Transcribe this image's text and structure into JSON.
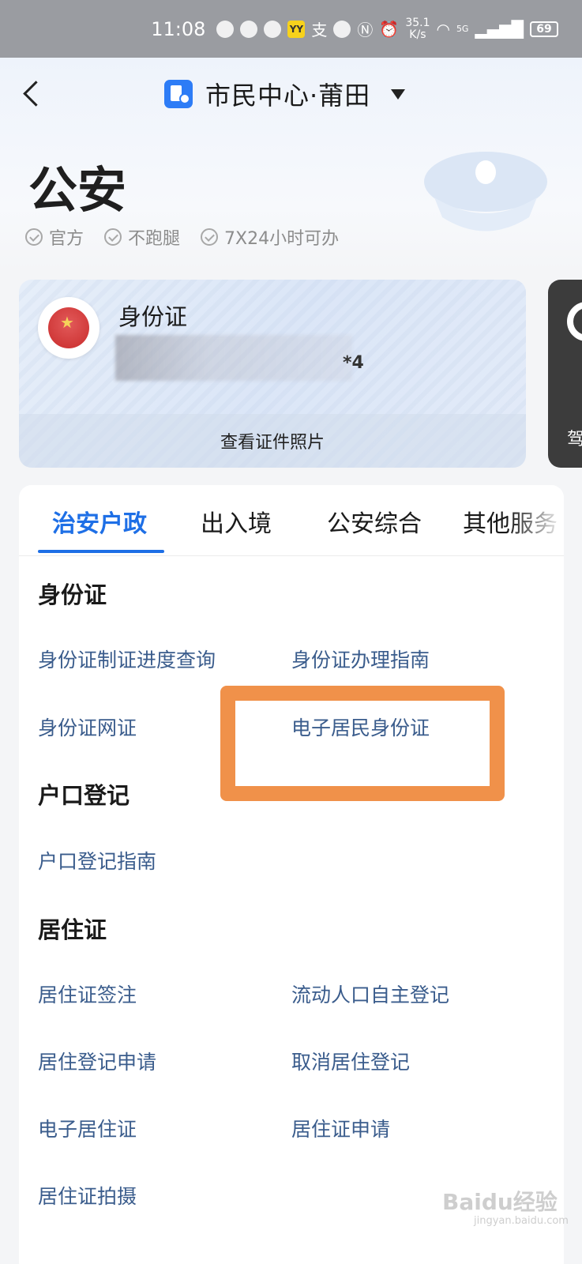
{
  "status_bar": {
    "time": "11:08",
    "net_speed_value": "35.1",
    "net_speed_unit": "K/s",
    "signal": "5G",
    "battery": "69"
  },
  "nav": {
    "title": "市民中心·莆田"
  },
  "header": {
    "title": "公安",
    "badges": [
      "官方",
      "不跑腿",
      "7X24小时可办"
    ]
  },
  "id_card": {
    "title": "身份证",
    "number_suffix": "*4",
    "view_photo_label": "查看证件照片"
  },
  "driver_card": {
    "label_partial": "驾"
  },
  "tabs": [
    "治安户政",
    "出入境",
    "公安综合",
    "其他服务"
  ],
  "sections": {
    "id": {
      "title": "身份证",
      "links": [
        "身份证制证进度查询",
        "身份证办理指南",
        "身份证网证",
        "电子居民身份证"
      ]
    },
    "hukou": {
      "title": "户口登记",
      "links": [
        "户口登记指南"
      ]
    },
    "residence": {
      "title": "居住证",
      "links": [
        "居住证签注",
        "流动人口自主登记",
        "居住登记申请",
        "取消居住登记",
        "电子居住证",
        "居住证申请",
        "居住证拍摄"
      ]
    }
  },
  "watermark": {
    "brand": "Baidu经验",
    "url": "jingyan.baidu.com"
  },
  "colors": {
    "accent": "#1e6fe6",
    "link": "#3a5c8c",
    "highlight": "#f0914a"
  }
}
